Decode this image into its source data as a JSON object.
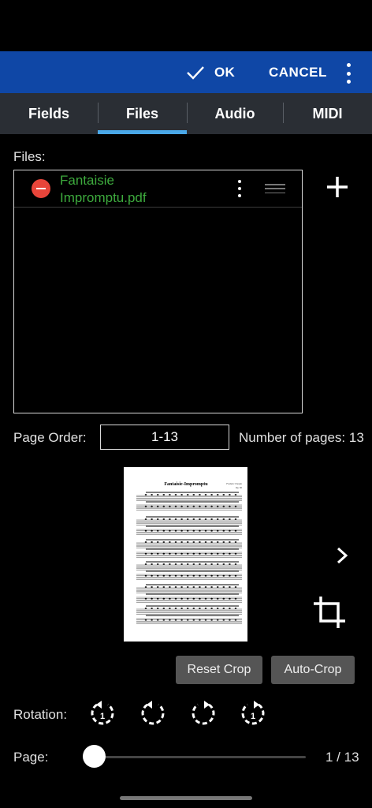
{
  "toolbar": {
    "ok_label": "OK",
    "cancel_label": "CANCEL"
  },
  "tabs": [
    {
      "label": "Fields"
    },
    {
      "label": "Files"
    },
    {
      "label": "Audio"
    },
    {
      "label": "MIDI"
    }
  ],
  "files": {
    "label": "Files:",
    "items": [
      {
        "name_line1": "Fantaisie",
        "name_line2": "Impromptu.pdf"
      }
    ]
  },
  "page_order": {
    "label": "Page Order:",
    "value": "1-13",
    "pages_label": "Number of pages:",
    "pages_value": "13"
  },
  "preview": {
    "title": "Fantaisie-Impromptu",
    "composer": "Frederic Chopin",
    "opus": "Op. 66"
  },
  "crop": {
    "reset_label": "Reset Crop",
    "auto_label": "Auto-Crop"
  },
  "rotation": {
    "label": "Rotation:"
  },
  "page": {
    "label": "Page:",
    "indicator": "1 / 13",
    "current": 1,
    "total": 13
  },
  "colors": {
    "appbar": "#0f47a6",
    "tab_indicator": "#4aa8e8",
    "file_name": "#3daa3d",
    "remove": "#e8453a"
  }
}
